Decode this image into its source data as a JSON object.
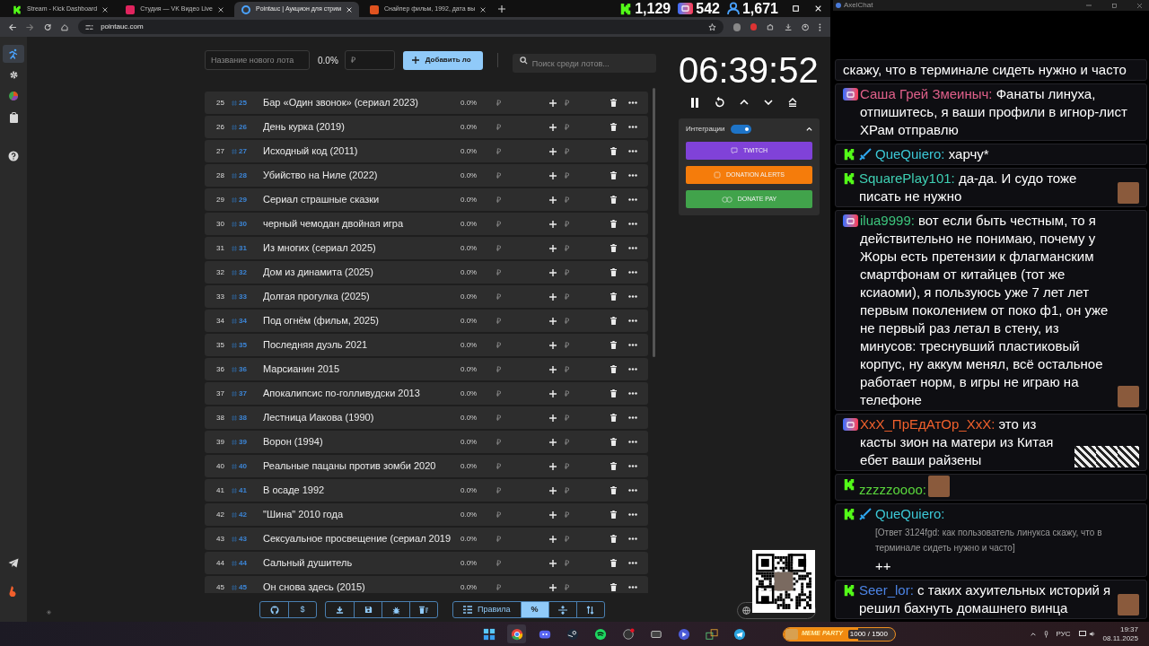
{
  "browser": {
    "tabs": [
      {
        "title": "Stream - Kick Dashboard",
        "selected": false,
        "kind": "kick"
      },
      {
        "title": "Студия — VK Видео Live",
        "selected": false,
        "kind": "vk"
      },
      {
        "title": "Pointauc | Аукцион для стрим",
        "selected": true,
        "kind": "pointauc"
      },
      {
        "title": "Снайпер фильм, 1992, дата вы",
        "selected": false,
        "kind": "film"
      }
    ],
    "stats": [
      {
        "kind": "kick",
        "value": "1,129"
      },
      {
        "kind": "vk",
        "value": "542"
      },
      {
        "kind": "viewers",
        "value": "1,671"
      }
    ],
    "url": "pointauc.com"
  },
  "sidebar": {
    "items": [
      {
        "selected": true
      },
      {
        "selected": false
      },
      {
        "selected": false
      },
      {
        "selected": false
      },
      {
        "selected": false
      }
    ],
    "bottom_items": [
      {
        "selected": false
      },
      {
        "selected": false
      }
    ]
  },
  "new_lot": {
    "name_placeholder": "Название нового лота",
    "percent": "0.0%",
    "amount_placeholder": "₽",
    "add_button": "Добавить ло",
    "search_placeholder": "Поиск среди лотов..."
  },
  "lots": [
    {
      "number": "25",
      "id": "25",
      "title": "Бар «Один звонок» (сериал 2023)",
      "percent": "0.0%",
      "amount_placeholder": "₽",
      "add_placeholder": "₽"
    },
    {
      "number": "26",
      "id": "26",
      "title": "День курка (2019)",
      "percent": "0.0%",
      "amount_placeholder": "₽",
      "add_placeholder": "₽"
    },
    {
      "number": "27",
      "id": "27",
      "title": "Исходный код (2011)",
      "percent": "0.0%",
      "amount_placeholder": "₽",
      "add_placeholder": "₽"
    },
    {
      "number": "28",
      "id": "28",
      "title": "Убийство на Ниле (2022)",
      "percent": "0.0%",
      "amount_placeholder": "₽",
      "add_placeholder": "₽"
    },
    {
      "number": "29",
      "id": "29",
      "title": "Сериал страшные сказки",
      "percent": "0.0%",
      "amount_placeholder": "₽",
      "add_placeholder": "₽"
    },
    {
      "number": "30",
      "id": "30",
      "title": "черный чемодан двойная игра",
      "percent": "0.0%",
      "amount_placeholder": "₽",
      "add_placeholder": "₽"
    },
    {
      "number": "31",
      "id": "31",
      "title": "Из многих (сериал 2025)",
      "percent": "0.0%",
      "amount_placeholder": "₽",
      "add_placeholder": "₽"
    },
    {
      "number": "32",
      "id": "32",
      "title": "Дом из динамита (2025)",
      "percent": "0.0%",
      "amount_placeholder": "₽",
      "add_placeholder": "₽"
    },
    {
      "number": "33",
      "id": "33",
      "title": "Долгая прогулка (2025)",
      "percent": "0.0%",
      "amount_placeholder": "₽",
      "add_placeholder": "₽"
    },
    {
      "number": "34",
      "id": "34",
      "title": "Под огнём (фильм, 2025)",
      "percent": "0.0%",
      "amount_placeholder": "₽",
      "add_placeholder": "₽"
    },
    {
      "number": "35",
      "id": "35",
      "title": "Последняя дуэль 2021",
      "percent": "0.0%",
      "amount_placeholder": "₽",
      "add_placeholder": "₽"
    },
    {
      "number": "36",
      "id": "36",
      "title": "Марсианин 2015",
      "percent": "0.0%",
      "amount_placeholder": "₽",
      "add_placeholder": "₽"
    },
    {
      "number": "37",
      "id": "37",
      "title": "Апокалипсис по-голливудски 2013",
      "percent": "0.0%",
      "amount_placeholder": "₽",
      "add_placeholder": "₽"
    },
    {
      "number": "38",
      "id": "38",
      "title": "Лестница Иакова (1990)",
      "percent": "0.0%",
      "amount_placeholder": "₽",
      "add_placeholder": "₽"
    },
    {
      "number": "39",
      "id": "39",
      "title": "Ворон (1994)",
      "percent": "0.0%",
      "amount_placeholder": "₽",
      "add_placeholder": "₽"
    },
    {
      "number": "40",
      "id": "40",
      "title": "Реальные пацаны против зомби 2020",
      "percent": "0.0%",
      "amount_placeholder": "₽",
      "add_placeholder": "₽"
    },
    {
      "number": "41",
      "id": "41",
      "title": "В осаде 1992",
      "percent": "0.0%",
      "amount_placeholder": "₽",
      "add_placeholder": "₽"
    },
    {
      "number": "42",
      "id": "42",
      "title": "\"Шина\" 2010 года",
      "percent": "0.0%",
      "amount_placeholder": "₽",
      "add_placeholder": "₽"
    },
    {
      "number": "43",
      "id": "43",
      "title": "Сексуальное просвещение (сериал 2019",
      "percent": "0.0%",
      "amount_placeholder": "₽",
      "add_placeholder": "₽"
    },
    {
      "number": "44",
      "id": "44",
      "title": "Сальный душитель",
      "percent": "0.0%",
      "amount_placeholder": "₽",
      "add_placeholder": "₽"
    },
    {
      "number": "45",
      "id": "45",
      "title": "Он снова здесь (2015)",
      "percent": "0.0%",
      "amount_placeholder": "₽",
      "add_placeholder": "₽"
    }
  ],
  "toolbar": {
    "groups": [
      [
        {
          "kind": "icon",
          "selected": false
        },
        {
          "kind": "text",
          "label": "$",
          "selected": false
        }
      ],
      [
        {
          "kind": "icon",
          "selected": false
        },
        {
          "kind": "icon",
          "selected": false
        },
        {
          "kind": "icon",
          "selected": false
        },
        {
          "kind": "icon",
          "selected": false
        }
      ],
      [
        {
          "kind": "icon_text",
          "label": "Правила",
          "selected": false
        },
        {
          "kind": "text",
          "label": "%",
          "selected": true
        },
        {
          "kind": "icon",
          "selected": false
        },
        {
          "kind": "icon",
          "selected": false
        }
      ]
    ]
  },
  "timer": {
    "time": "06:39:52"
  },
  "integrations": {
    "label": "Интеграции",
    "on": true,
    "expanded": true,
    "buttons": [
      {
        "kind": "twitch",
        "label": "TWITCH"
      },
      {
        "kind": "donationalerts",
        "label": "DONATION ALERTS"
      },
      {
        "kind": "donatepay",
        "label": "DONATE PAY"
      }
    ]
  },
  "meme_party": {
    "label": "MEME PARTY",
    "reading": "1000 / 1500",
    "level": 0.667
  },
  "chat": {
    "title": "AxelChat",
    "messages": [
      {
        "kind": "continuation",
        "text": "скажу, что в терминале сидеть нужно и часто"
      },
      {
        "kind": "vk",
        "user": "Саша Грей Змеиныч:",
        "color": "#e0608a",
        "text": "Фанаты линуха, отпишитесь, я ваши профили в игнор-лист ХРам отправлю"
      },
      {
        "kind": "kick",
        "badge": true,
        "user": "QueQuiero:",
        "color": "#3cc8d6",
        "text": "харчу*"
      },
      {
        "kind": "kick",
        "user": "SquarePlay101:",
        "color": "#3fd0b4",
        "text": "да-да. И судо тоже писать не нужно",
        "emotes": [
          {
            "kind": "photo"
          }
        ]
      },
      {
        "kind": "vk",
        "user": "ilua9999:",
        "color": "#3cc47c",
        "text": "вот если быть честным, то я действительно не понимаю, почему у Жоры есть претензии к флагманским смартфонам от китайцев (тот же ксиаоми), я пользуюсь уже 7 лет лет первым поколением от поко ф1, он уже не первый раз летал в стену, из минусов: треснувший пластиковый корпус, ну аккум менял, всё остальное работает норм, в игры не играю на телефоне",
        "emotes": [
          {
            "kind": "photo"
          }
        ]
      },
      {
        "kind": "vk",
        "user": "XxX_ПрЕдАтОр_XxX:",
        "color": "#f0602c",
        "text": "это из касты зион на матери из Китая ебет ваши райзены",
        "emotes": [
          {
            "kind": "pattern"
          },
          {
            "kind": "pattern"
          },
          {
            "kind": "pattern"
          }
        ]
      },
      {
        "kind": "kick",
        "user": "zzzzzoooo:",
        "color": "#5ad63c",
        "emotes": [
          {
            "kind": "photo"
          }
        ]
      },
      {
        "kind": "kick",
        "badge": true,
        "user": "QueQuiero:",
        "color": "#3cc8d6",
        "reply": "[Ответ 3124fgd: как пользователь линукса скажу, что в терминале сидеть нужно и часто]",
        "text": "++"
      },
      {
        "kind": "kick",
        "user": "Seer_lor:",
        "color": "#4c84e6",
        "text": "с таких ахуительных историй я решил бахнуть домашнего винца",
        "emotes": [
          {
            "kind": "photo"
          }
        ]
      }
    ]
  },
  "tray": {
    "language": "РУС",
    "time": "19:37",
    "date": "08.11.2025"
  }
}
